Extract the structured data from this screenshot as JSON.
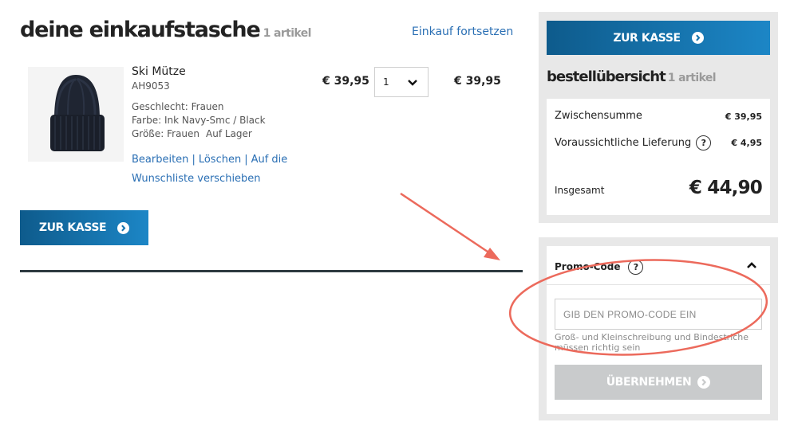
{
  "header": {
    "title": "deine einkaufstasche",
    "item_count": "1 artikel",
    "continue_link": "Einkauf fortsetzen"
  },
  "cart_item": {
    "name": "Ski Mütze",
    "sku": "AH9053",
    "gender": "Geschlecht: Frauen",
    "color": "Farbe: Ink Navy-Smc / Black",
    "size": "Größe: Frauen",
    "stock": "Auf Lager",
    "unit_price": "€ 39,95",
    "quantity": "1",
    "line_total": "€ 39,95",
    "actions": {
      "edit": "Bearbeiten",
      "delete": "Löschen",
      "wishlist": "Auf die Wunschliste verschieben"
    }
  },
  "checkout": {
    "button_label": "ZUR KASSE"
  },
  "overview": {
    "title": "bestellübersicht",
    "item_count": "1 artikel",
    "subtotal_label": "Zwischensumme",
    "subtotal_value": "€ 39,95",
    "shipping_label": "Voraussichtliche Lieferung",
    "shipping_value": "€ 4,95",
    "help_glyph": "?",
    "total_label": "Insgesamt",
    "total_value": "€ 44,90"
  },
  "promo": {
    "title": "Promo-Code",
    "input_placeholder": "GIB DEN PROMO-CODE EIN",
    "hint": "Groß- und Kleinschreibung und Bindestriche müssen richtig sein",
    "apply_label": "ÜBERNEHMEN",
    "expanded": true
  },
  "icons": {
    "arrow": "circle-chevron-right-icon",
    "qty_chevron": "chevron-down-icon",
    "promo_chevron": "chevron-up-icon",
    "help": "help-icon"
  },
  "colors": {
    "accent_blue_dark": "#0e5b8c",
    "accent_blue_light": "#1c86c6",
    "link": "#2a6fb4",
    "annotation": "#ec6a5c",
    "panel_gray": "#e8e8e8",
    "disabled_button": "#c9cbcc"
  }
}
